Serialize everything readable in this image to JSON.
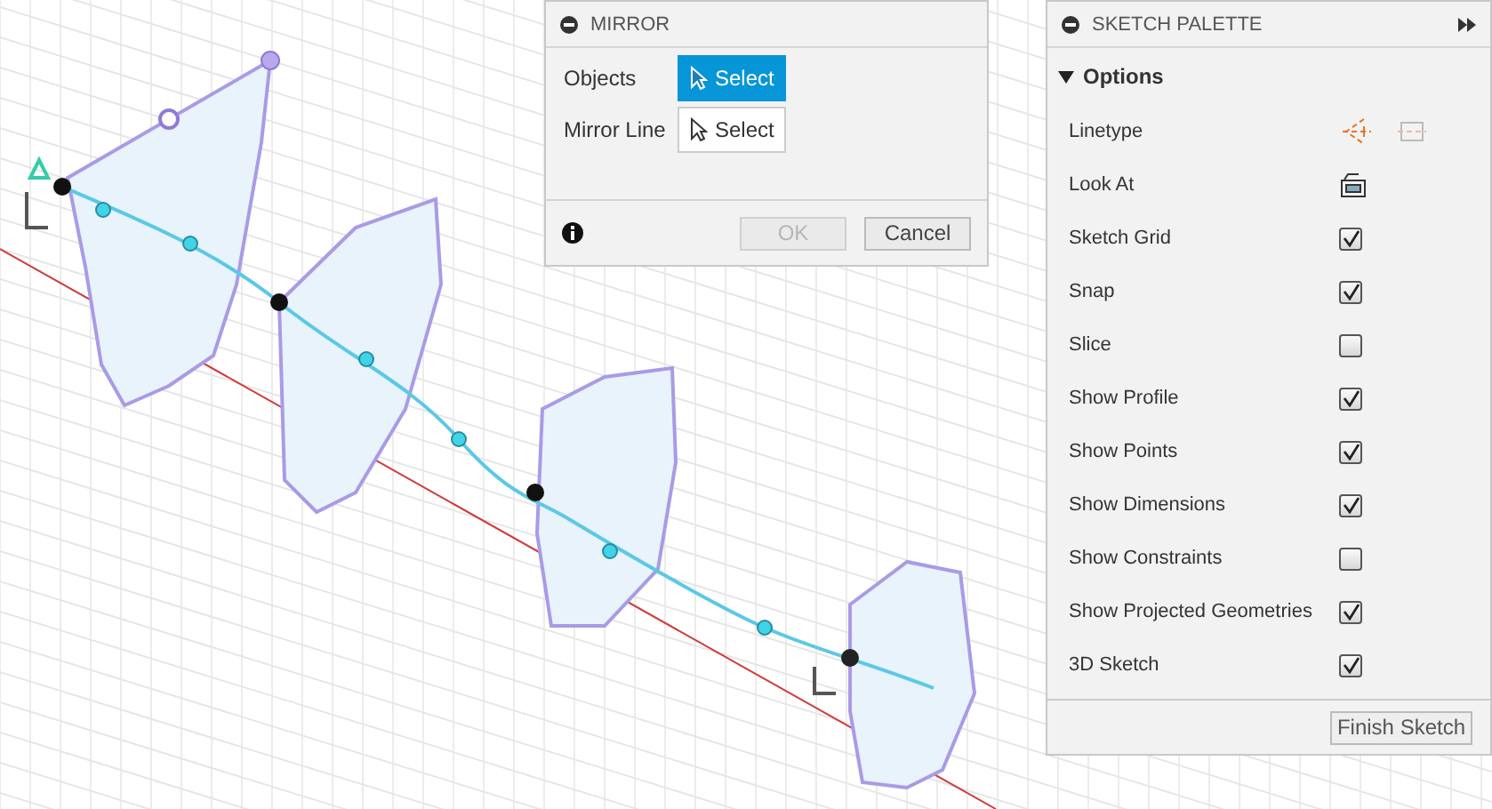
{
  "mirror_dialog": {
    "title": "MIRROR",
    "inputs": [
      {
        "label": "Objects",
        "button": "Select",
        "selected": true
      },
      {
        "label": "Mirror Line",
        "button": "Select",
        "selected": false
      }
    ],
    "buttons": [
      {
        "label": "OK",
        "disabled": true
      },
      {
        "label": "Cancel",
        "disabled": false
      }
    ]
  },
  "sketch_palette": {
    "title": "SKETCH PALETTE",
    "section": {
      "label": "Options",
      "expanded": true
    },
    "rows": [
      {
        "kind": "linetype",
        "label": "Linetype"
      },
      {
        "kind": "lookat",
        "label": "Look At"
      },
      {
        "kind": "checkbox",
        "label": "Sketch Grid",
        "checked": true
      },
      {
        "kind": "checkbox",
        "label": "Snap",
        "checked": true
      },
      {
        "kind": "checkbox",
        "label": "Slice",
        "checked": false
      },
      {
        "kind": "checkbox",
        "label": "Show Profile",
        "checked": true
      },
      {
        "kind": "checkbox",
        "label": "Show Points",
        "checked": true
      },
      {
        "kind": "checkbox",
        "label": "Show Dimensions",
        "checked": true
      },
      {
        "kind": "checkbox",
        "label": "Show Constraints",
        "checked": false
      },
      {
        "kind": "checkbox",
        "label": "Show Projected Geometries",
        "checked": true
      },
      {
        "kind": "checkbox",
        "label": "3D Sketch",
        "checked": true
      }
    ],
    "finish_button": "Finish Sketch"
  }
}
